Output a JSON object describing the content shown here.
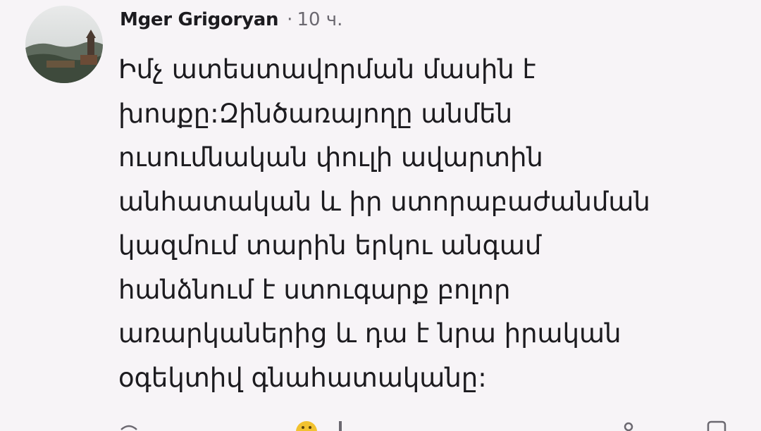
{
  "comment": {
    "author": "Mger Grigoryan",
    "separator": "·",
    "time": "10 ч.",
    "lines": [
      "Իմչ ատեստավորման մասին է",
      "խոսքը:Զինծառայողը անմեն",
      "ուսումնական փուլի ավարտին",
      "անհատական և իր ստորաբաժանման",
      "կազմում տարին երկու անգամ",
      "հանձնում է ստուգարք բոլոր",
      "առարկաներից և դա է նրա իրական",
      "օգեկտիվ գնահատականը:"
    ]
  },
  "actions": {
    "icons": [
      "reply-icon",
      "emoji-reaction-icon",
      "like-icon",
      "more-icon"
    ]
  },
  "colors": {
    "background": "#f7f4f7",
    "text": "#1c1b1f",
    "muted": "#6b6870"
  }
}
